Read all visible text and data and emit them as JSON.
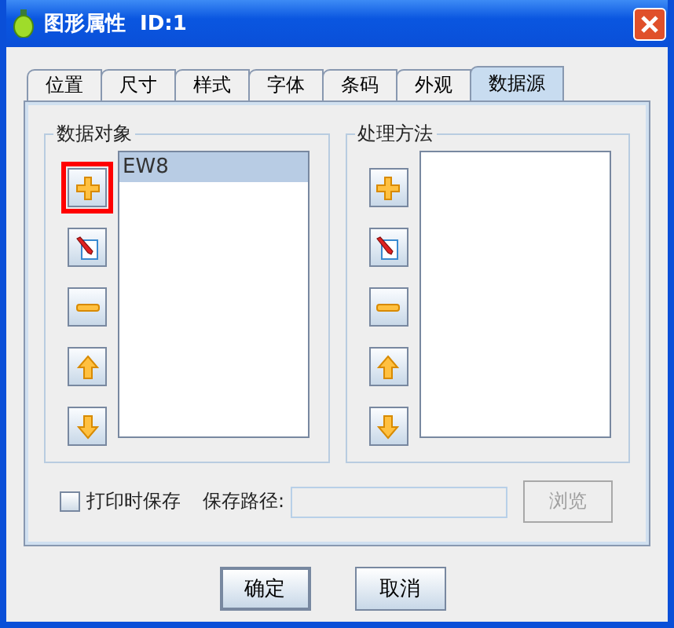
{
  "window": {
    "title": "图形属性  ID:1"
  },
  "tabs": [
    {
      "label": "位置",
      "selected": false
    },
    {
      "label": "尺寸",
      "selected": false
    },
    {
      "label": "样式",
      "selected": false
    },
    {
      "label": "字体",
      "selected": false
    },
    {
      "label": "条码",
      "selected": false
    },
    {
      "label": "外观",
      "selected": false
    },
    {
      "label": "数据源",
      "selected": true
    }
  ],
  "groups": [
    {
      "title": "数据对象",
      "buttons": [
        {
          "kind": "add",
          "highlighted": true
        },
        {
          "kind": "edit",
          "highlighted": false
        },
        {
          "kind": "remove",
          "highlighted": false
        },
        {
          "kind": "up",
          "highlighted": false
        },
        {
          "kind": "down",
          "highlighted": false
        }
      ],
      "items": [
        {
          "label": "EW8",
          "selected": true
        }
      ]
    },
    {
      "title": "处理方法",
      "buttons": [
        {
          "kind": "add",
          "highlighted": false
        },
        {
          "kind": "edit",
          "highlighted": false
        },
        {
          "kind": "remove",
          "highlighted": false
        },
        {
          "kind": "up",
          "highlighted": false
        },
        {
          "kind": "down",
          "highlighted": false
        }
      ]
    }
  ],
  "save_on_print": {
    "label": "打印时保存",
    "checked": false
  },
  "save_path": {
    "label": "保存路径:",
    "browse": "浏览",
    "disabled": true
  },
  "buttons": [
    "确定",
    "取消"
  ]
}
